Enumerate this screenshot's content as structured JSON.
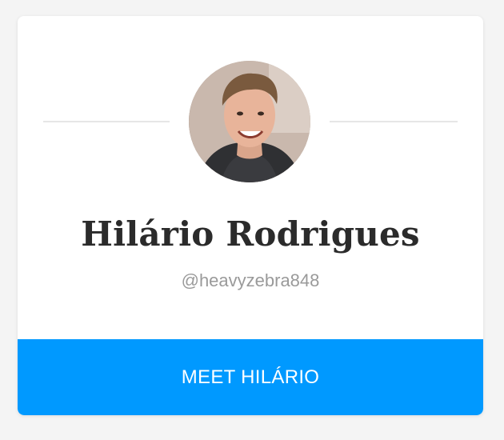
{
  "profile": {
    "name": "Hilário Rodrigues",
    "handle": "@heavyzebra848",
    "avatar_icon": "user-avatar-photo"
  },
  "actions": {
    "meet_label": "MEET HILÁRIO"
  },
  "colors": {
    "accent": "#0099ff",
    "name_text": "#2b2b2b",
    "handle_text": "#9a9a9a",
    "divider": "#e6e6e6",
    "background": "#f4f4f4"
  }
}
